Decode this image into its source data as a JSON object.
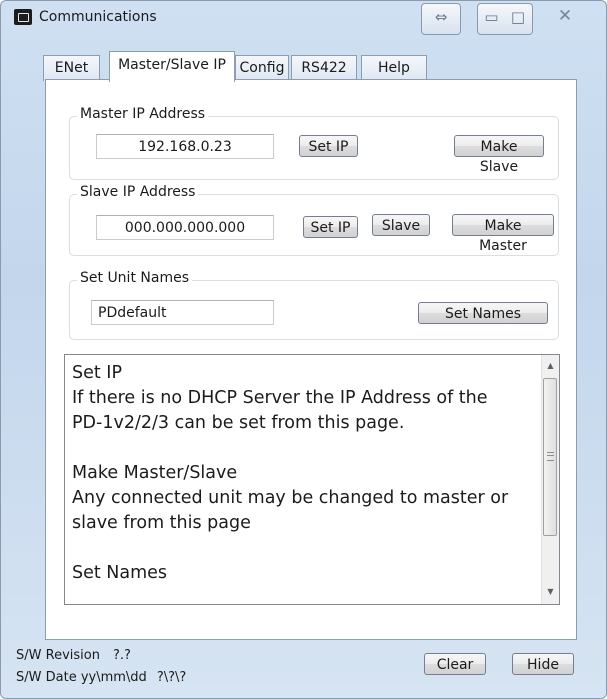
{
  "window": {
    "title": "Communications",
    "controls": {
      "resize": "⇔",
      "minimize": "▭",
      "maximize": "□",
      "close": "✕"
    }
  },
  "tabs": [
    {
      "label": "ENet",
      "selected": false
    },
    {
      "label": "Master/Slave IP",
      "selected": true
    },
    {
      "label": "Config",
      "selected": false
    },
    {
      "label": "RS422",
      "selected": false
    },
    {
      "label": "Help",
      "selected": false
    }
  ],
  "master_group": {
    "label": "Master IP Address",
    "ip_value": "192.168.0.23",
    "set_ip_label": "Set IP",
    "make_slave_label": "Make Slave"
  },
  "slave_group": {
    "label": "Slave IP Address",
    "ip_value": "000.000.000.000",
    "set_ip_label": "Set IP",
    "slave_label": "Slave",
    "make_master_label": "Make Master"
  },
  "names_group": {
    "label": "Set Unit Names",
    "name_value": "PDdefault",
    "set_names_label": "Set Names"
  },
  "help_text": {
    "lines": [
      "Set IP",
      "If there is no DHCP Server the IP Address of the",
      "PD-1v2/2/3 can be set from this page.",
      "",
      "Make Master/Slave",
      "Any connected unit may be changed to master or",
      "slave from this page",
      "",
      "Set Names"
    ]
  },
  "scrollbar": {
    "up_icon": "▲",
    "down_icon": "▼"
  },
  "status": {
    "revision_label": "S/W Revision",
    "revision_value": "?.?",
    "date_label": "S/W Date yy\\mm\\dd",
    "date_value": "?\\?\\?"
  },
  "buttons": {
    "clear": "Clear",
    "hide": "Hide"
  },
  "colors": {
    "window_frame": "#c3d6ec",
    "panel": "#ffffff"
  }
}
